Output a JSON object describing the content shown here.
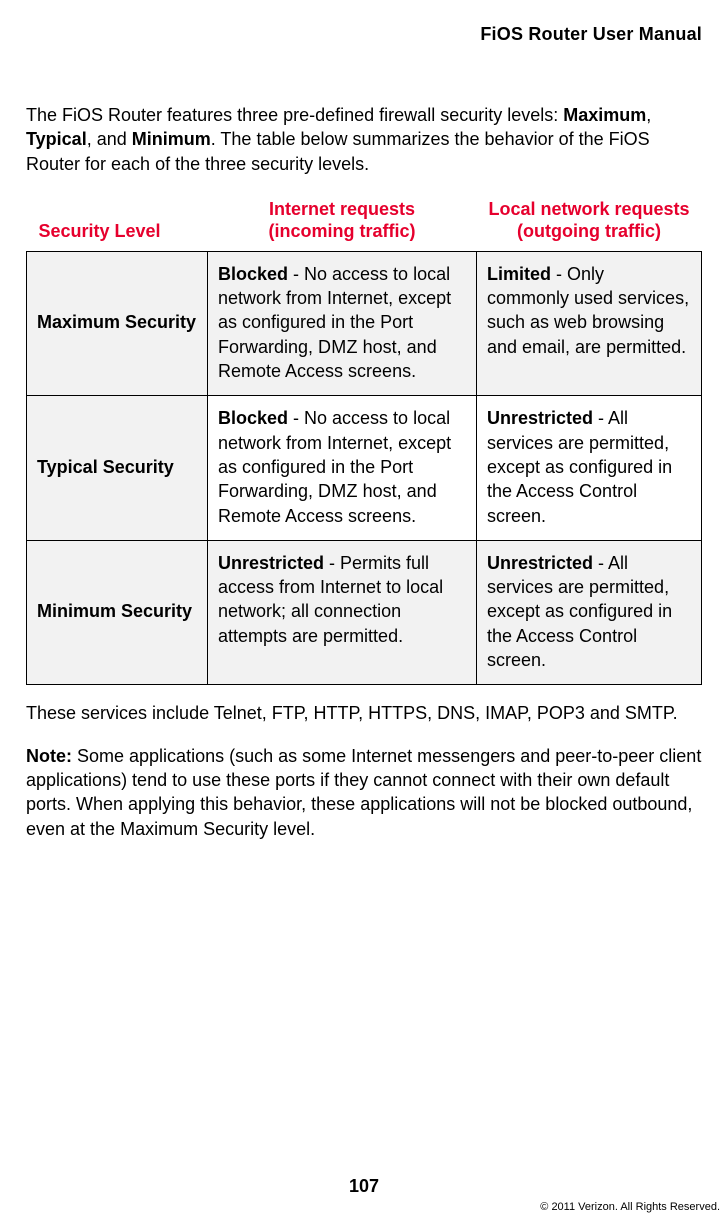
{
  "header": {
    "title": "FiOS Router User Manual"
  },
  "intro": {
    "pre": "The FiOS Router features three pre-defined firewall security levels: ",
    "b1": "Maximum",
    "sep1": ", ",
    "b2": "Typical",
    "sep2": ", and ",
    "b3": "Minimum",
    "post": ". The table below summarizes the behavior of the FiOS Router for each of the three security levels."
  },
  "table": {
    "headers": {
      "level": "Security Level",
      "incoming_l1": "Internet requests",
      "incoming_l2": "(incoming traffic)",
      "outgoing_l1": "Local network requests",
      "outgoing_l2": "(outgoing traffic)"
    },
    "rows": [
      {
        "level": "Maximum Security",
        "in_b": "Blocked",
        "in_pre": " - No access to local network from Internet, except as configured in the Port Forwarding, ",
        "in_sc": "DMZ",
        "in_post": " host, and Remote Access screens.",
        "out_b": "Limited",
        "out_t": " - Only commonly used services, such as web browsing and email, are permitted."
      },
      {
        "level": "Typical Security",
        "in_b": "Blocked",
        "in_pre": " - No access to local network from Internet, except as configured in the Port Forwarding, ",
        "in_sc": "DMZ",
        "in_post": " host, and Remote Access screens.",
        "out_b": "Unrestricted",
        "out_t": " - All services are permitted, except as configured in the Access Control screen."
      },
      {
        "level": "Minimum Security",
        "in_b": "Unrestricted",
        "in_pre": " - Permits full access from Internet to local network; all connection attempts are permitted.",
        "in_sc": "",
        "in_post": "",
        "out_b": "Unrestricted",
        "out_t": " - All services are permitted, except as configured in the Access Control screen."
      }
    ]
  },
  "after_table": "These services include Telnet, FTP, HTTP, HTTPS, DNS, IMAP, POP3 and SMTP.",
  "note": {
    "label": "Note:",
    "text": " Some applications (such as some Internet messengers and peer-to-peer client applications) tend to use these ports if they cannot connect with their own default ports. When applying this behavior, these applications will not be blocked outbound, even at the Maximum Security level."
  },
  "footer": {
    "page": "107",
    "copyright": "© 2011 Verizon. All Rights Reserved."
  }
}
